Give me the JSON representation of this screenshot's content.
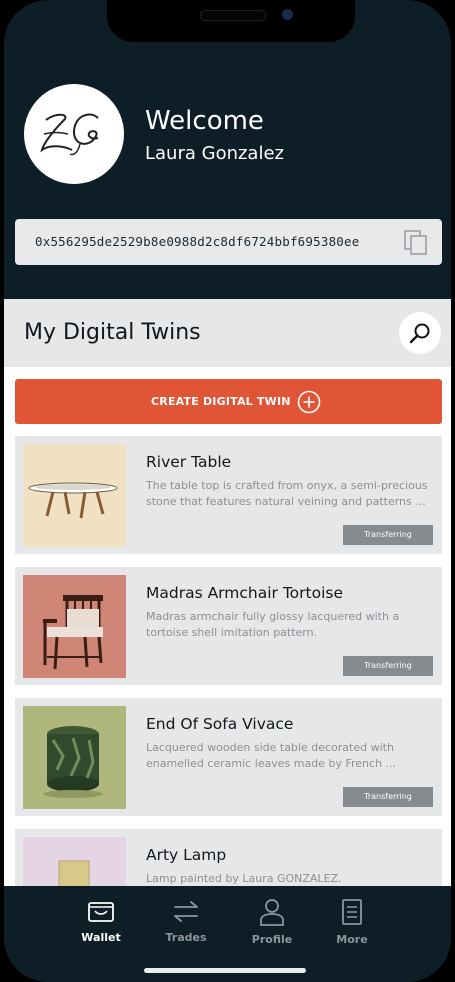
{
  "header": {
    "avatar_initials": "ZG",
    "welcome": "Welcome",
    "username": "Laura Gonzalez",
    "wallet_address": "0x556295de2529b8e0988d2c8df6724bbf695380ee"
  },
  "section": {
    "title": "My Digital Twins",
    "create_label": "CREATE  DIGITAL TWIN"
  },
  "items": [
    {
      "title": "River Table",
      "description": "The table top is crafted from onyx, a semi-precious stone that features natural veining and patterns ...",
      "status": "Transferring"
    },
    {
      "title": "Madras Armchair Tortoise",
      "description": "Madras armchair fully glossy lacquered with a tortoise shell imitation pattern.",
      "status": "Transferring"
    },
    {
      "title": "End Of Sofa Vivace",
      "description": "Lacquered wooden side table decorated with enamelled ceramic leaves made by French ...",
      "status": "Transferring"
    },
    {
      "title": "Arty Lamp",
      "description": "Lamp painted by Laura GONZALEZ.",
      "status": ""
    }
  ],
  "tabs": [
    {
      "label": "Wallet",
      "icon": "wallet-icon",
      "active": true
    },
    {
      "label": "Trades",
      "icon": "transfer-arrows-icon",
      "active": false
    },
    {
      "label": "Profile",
      "icon": "person-icon",
      "active": false
    },
    {
      "label": "More",
      "icon": "document-icon",
      "active": false
    }
  ],
  "colors": {
    "header_bg": "#0e1e26",
    "accent": "#e05535",
    "card_bg": "#e6e7e8",
    "badge_bg": "#868b8f",
    "active_tab": "#ffffff",
    "inactive_tab": "#8d959c"
  }
}
